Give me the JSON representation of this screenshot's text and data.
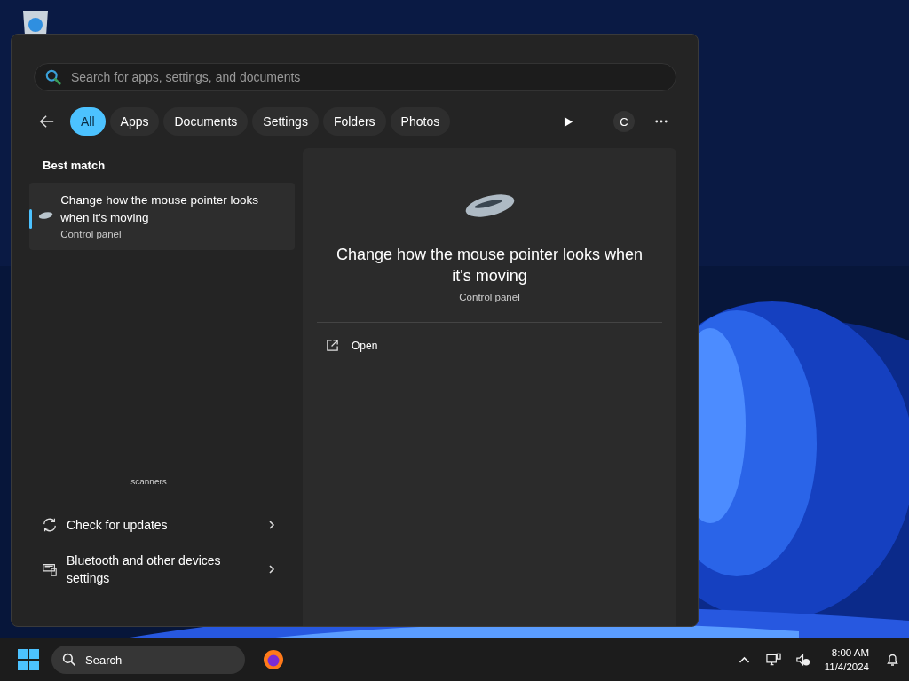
{
  "search": {
    "placeholder": "Search for apps, settings, and documents"
  },
  "filters": [
    {
      "label": "All",
      "selected": true
    },
    {
      "label": "Apps",
      "selected": false
    },
    {
      "label": "Documents",
      "selected": false
    },
    {
      "label": "Settings",
      "selected": false
    },
    {
      "label": "Folders",
      "selected": false
    },
    {
      "label": "Photos",
      "selected": false
    }
  ],
  "account": {
    "initial": "C"
  },
  "best_match": {
    "heading": "Best match",
    "title": "Change how the mouse pointer looks when it's moving",
    "subtitle": "Control panel",
    "selected": true
  },
  "partial_text": "scanners",
  "settings_results": [
    {
      "label": "Check for updates",
      "kind": "refresh"
    },
    {
      "label": "Bluetooth and other devices settings",
      "kind": "devices"
    }
  ],
  "preview": {
    "title": "Change how the mouse pointer looks when it's moving",
    "subtitle": "Control panel",
    "actions": [
      {
        "label": "Open",
        "kind": "open"
      }
    ]
  },
  "taskbar": {
    "search_label": "Search",
    "time": "8:00 AM",
    "date": "11/4/2024"
  }
}
